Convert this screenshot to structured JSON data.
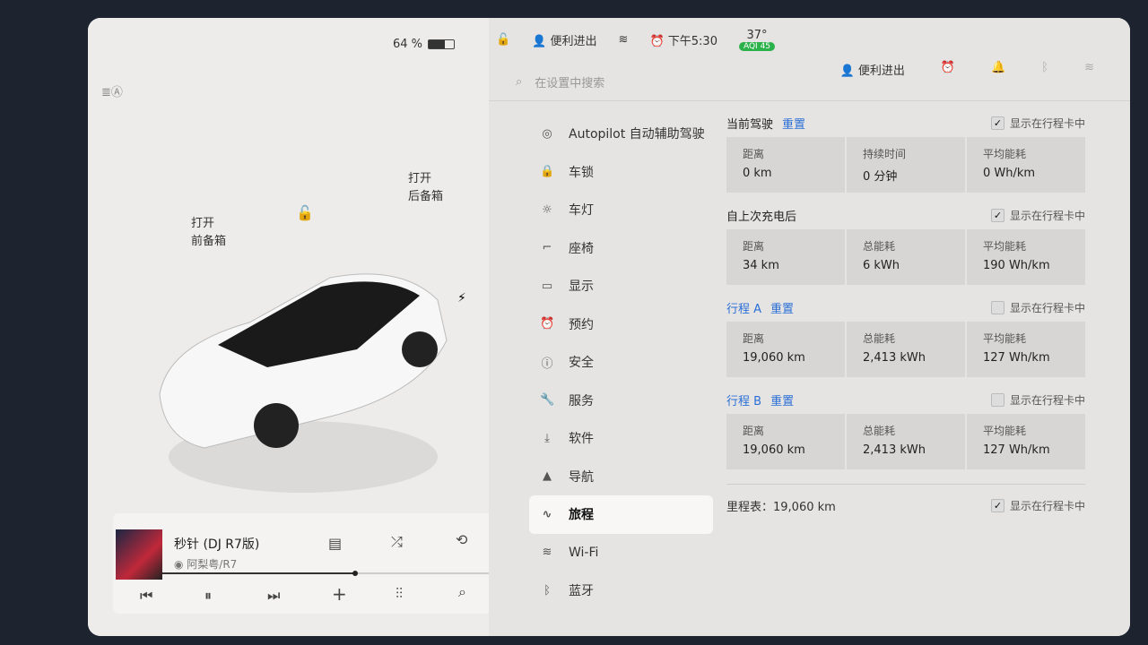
{
  "status": {
    "battery": "64 %",
    "battery_level": 0.64,
    "profile": "便利进出",
    "time": "下午5:30",
    "temp": "37°",
    "aqi": "AQI 45"
  },
  "search": {
    "placeholder": "在设置中搜索"
  },
  "header": {
    "profile": "便利进出"
  },
  "car": {
    "frunk_action": "打开",
    "frunk": "前备箱",
    "trunk_action": "打开",
    "trunk": "后备箱"
  },
  "menu": [
    {
      "icon": "steering-wheel-icon",
      "glyph": "◎",
      "label": "Autopilot 自动辅助驾驶"
    },
    {
      "icon": "lock-icon",
      "glyph": "🔒",
      "label": "车锁"
    },
    {
      "icon": "light-icon",
      "glyph": "☼",
      "label": "车灯"
    },
    {
      "icon": "seat-icon",
      "glyph": "⌐",
      "label": "座椅"
    },
    {
      "icon": "display-icon",
      "glyph": "▭",
      "label": "显示"
    },
    {
      "icon": "alarm-icon",
      "glyph": "⏰",
      "label": "预约"
    },
    {
      "icon": "safety-icon",
      "glyph": "ⓘ",
      "label": "安全"
    },
    {
      "icon": "wrench-icon",
      "glyph": "🔧",
      "label": "服务"
    },
    {
      "icon": "download-icon",
      "glyph": "⤓",
      "label": "软件"
    },
    {
      "icon": "navigation-icon",
      "glyph": "▲",
      "label": "导航"
    },
    {
      "icon": "trip-icon",
      "glyph": "∿",
      "label": "旅程"
    },
    {
      "icon": "wifi-icon",
      "glyph": "≋",
      "label": "Wi-Fi"
    },
    {
      "icon": "bluetooth-icon",
      "glyph": "ᛒ",
      "label": "蓝牙"
    }
  ],
  "trips": [
    {
      "title": "当前驾驶",
      "reset": "重置",
      "show": "显示在行程卡中",
      "checked": true,
      "cells": [
        {
          "l": "距离",
          "v": "0 km"
        },
        {
          "l": "持续时间",
          "v": "0 分钟"
        },
        {
          "l": "平均能耗",
          "v": "0 Wh/km"
        }
      ]
    },
    {
      "title": "自上次充电后",
      "reset": "",
      "show": "显示在行程卡中",
      "checked": true,
      "cells": [
        {
          "l": "距离",
          "v": "34 km"
        },
        {
          "l": "总能耗",
          "v": "6 kWh"
        },
        {
          "l": "平均能耗",
          "v": "190 Wh/km"
        }
      ]
    },
    {
      "title": "行程 A",
      "reset": "重置",
      "show": "显示在行程卡中",
      "checked": false,
      "cells": [
        {
          "l": "距离",
          "v": "19,060 km"
        },
        {
          "l": "总能耗",
          "v": "2,413 kWh"
        },
        {
          "l": "平均能耗",
          "v": "127 Wh/km"
        }
      ]
    },
    {
      "title": "行程 B",
      "reset": "重置",
      "show": "显示在行程卡中",
      "checked": false,
      "cells": [
        {
          "l": "距离",
          "v": "19,060 km"
        },
        {
          "l": "总能耗",
          "v": "2,413 kWh"
        },
        {
          "l": "平均能耗",
          "v": "127 Wh/km"
        }
      ]
    }
  ],
  "odometer": {
    "label": "里程表：19,060 km",
    "show": "显示在行程卡中",
    "checked": true
  },
  "media": {
    "title": "秒针 (DJ R7版)",
    "artist": "阿梨粤/R7",
    "progress": 0.58
  }
}
